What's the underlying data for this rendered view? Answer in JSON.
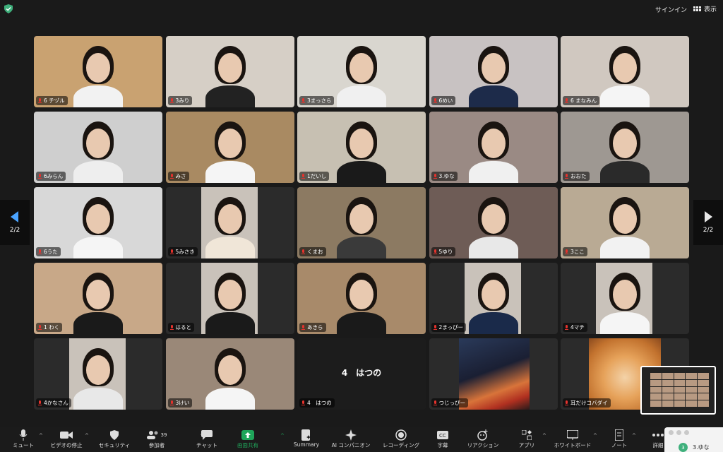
{
  "topbar": {
    "signin": "サインイン",
    "view": "表示"
  },
  "pager": {
    "left": "2/2",
    "right": "2/2"
  },
  "tiles": [
    {
      "name": "6 チヅル",
      "bg": "#c9a271"
    },
    {
      "name": "3みり",
      "bg": "#d6cfc6"
    },
    {
      "name": "3まっさら",
      "bg": "#d9d6cf"
    },
    {
      "name": "6めい",
      "bg": "#c8c2c2"
    },
    {
      "name": "6 まなみん",
      "bg": "#d0c8c0"
    },
    {
      "name": "6みらん",
      "bg": "#cfcfcf"
    },
    {
      "name": "みさ",
      "bg": "#a98a62"
    },
    {
      "name": "1だいし",
      "bg": "#c7c0b2"
    },
    {
      "name": "3.ゆな",
      "bg": "#9a8a84"
    },
    {
      "name": "おおた",
      "bg": "#9e9892"
    },
    {
      "name": "6うた",
      "bg": "#d8d8d8"
    },
    {
      "name": "5みさき",
      "bg": "#2b2b2b"
    },
    {
      "name": "くまお",
      "bg": "#8c7a62"
    },
    {
      "name": "5ゆり",
      "bg": "#6e5c56"
    },
    {
      "name": "3ここ",
      "bg": "#b9aa94"
    },
    {
      "name": "1 わく",
      "bg": "#c8a888"
    },
    {
      "name": "はると",
      "bg": "#2b2b2b"
    },
    {
      "name": "あきら",
      "bg": "#a88a6a"
    },
    {
      "name": "2まっぴー",
      "bg": "#2b2b2b"
    },
    {
      "name": "4マチ",
      "bg": "#2b2b2b"
    },
    {
      "name": "4かなさん",
      "bg": "#2b2b2b"
    },
    {
      "name": "3けい",
      "bg": "#9a8878"
    },
    {
      "name": "4　はつの",
      "bg": "#1c1c1c"
    },
    {
      "name": "つじっぴー",
      "bg": "#2b2b2b"
    },
    {
      "name": "耳だけコバダイ",
      "bg": "#2b2b2b"
    }
  ],
  "center_label": "4　はつの",
  "toolbar": [
    {
      "label": "ミュート",
      "icon": "microphone-icon"
    },
    {
      "label": "ビデオの停止",
      "icon": "video-camera-icon"
    },
    {
      "label": "セキュリティ",
      "icon": "shield-icon"
    },
    {
      "label": "参加者",
      "icon": "participants-icon",
      "count": "39"
    },
    {
      "label": "チャット",
      "icon": "chat-icon"
    },
    {
      "label": "画面共有",
      "icon": "share-screen-icon"
    },
    {
      "label": "Summary",
      "icon": "summary-icon"
    },
    {
      "label": "AI コンパニオン",
      "icon": "ai-sparkle-icon"
    },
    {
      "label": "レコーディング",
      "icon": "record-icon"
    },
    {
      "label": "字幕",
      "icon": "captions-icon"
    },
    {
      "label": "リアクション",
      "icon": "reaction-icon"
    },
    {
      "label": "アプリ",
      "icon": "apps-icon"
    },
    {
      "label": "ホワイトボード",
      "icon": "whiteboard-icon"
    },
    {
      "label": "ノート",
      "icon": "notes-icon"
    },
    {
      "label": "詳細",
      "icon": "more-icon"
    }
  ],
  "chat_popup": {
    "badge": "3",
    "name": "3.ゆな"
  },
  "colors": {
    "share_green": "#1fa55a",
    "mic_red": "#e5322d"
  }
}
